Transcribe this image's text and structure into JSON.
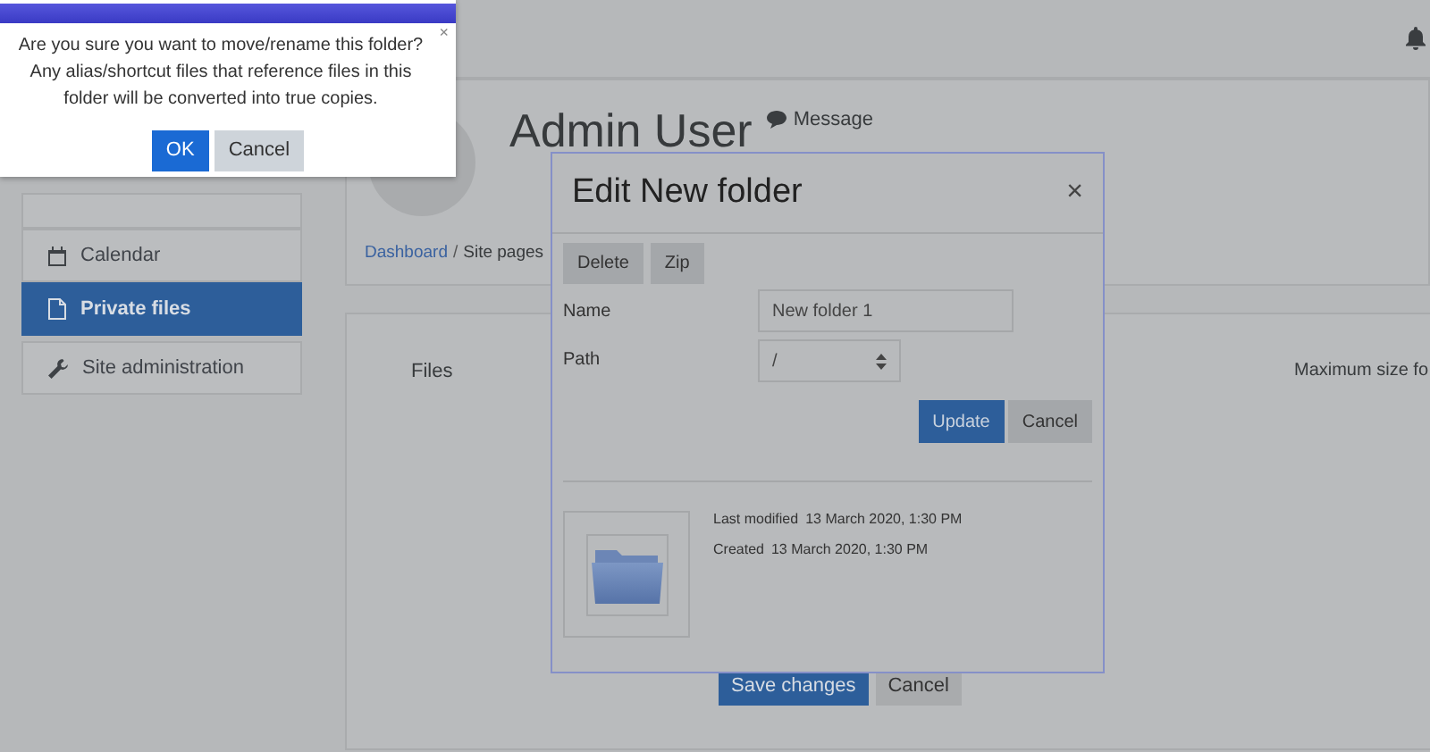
{
  "sidebar": {
    "items": [
      {
        "label": "Calendar",
        "selected": false
      },
      {
        "label": "Private files",
        "selected": true
      },
      {
        "label": "Site administration",
        "selected": false
      }
    ]
  },
  "profile": {
    "name": "Admin User",
    "message_link": "Message"
  },
  "breadcrumb": {
    "separator": "/",
    "items": [
      "Dashboard",
      "Site pages"
    ]
  },
  "files_form": {
    "label": "Files",
    "column_2": "Maximum size fo",
    "buttons": [
      "Save changes",
      "Cancel"
    ]
  },
  "edit_dialog": {
    "title": "Edit New folder",
    "close": "×",
    "toolbar": [
      "Delete",
      "Zip"
    ],
    "fields": [
      {
        "kind": "text",
        "label": "Name",
        "value": "New folder 1"
      },
      {
        "kind": "select",
        "label": "Path",
        "value": "/"
      }
    ],
    "buttons": [
      "Update",
      "Cancel"
    ],
    "info": [
      {
        "label": "Last modified",
        "value": "13 March 2020, 1:30 PM"
      },
      {
        "label": "Created",
        "value": "13 March 2020, 1:30 PM"
      }
    ]
  },
  "confirm": {
    "close": "×",
    "message": "Are you sure you want to move/rename this folder? Any alias/shortcut files that reference files in this folder will be converted into true copies.",
    "buttons": [
      "OK",
      "Cancel"
    ]
  }
}
